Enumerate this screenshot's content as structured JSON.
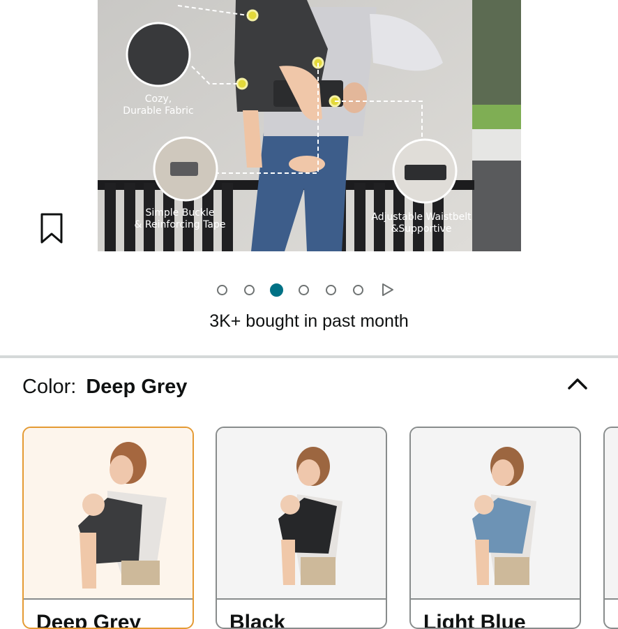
{
  "hero": {
    "callouts": [
      {
        "line1": "Cozy,",
        "line2": "Durable Fabric"
      },
      {
        "line1": "Simple Buckle",
        "line2": "& Reinforcing Tape"
      },
      {
        "line1": "Adjustable Waistbelt",
        "line2": "&Supportive"
      }
    ]
  },
  "carousel": {
    "dot_count": 6,
    "active_index": 2
  },
  "social_proof": "3K+ bought in past month",
  "color": {
    "label": "Color:",
    "selected": "Deep Grey"
  },
  "swatches": [
    {
      "name": "Deep Grey",
      "fabric": "#3b3c3e",
      "selected": true
    },
    {
      "name": "Black",
      "fabric": "#262729",
      "selected": false
    },
    {
      "name": "Light Blue",
      "fabric": "#6d93b5",
      "selected": false
    }
  ],
  "colors": {
    "accent_teal": "#007185",
    "selected_border": "#e49a33",
    "border_grey": "#888c8c"
  }
}
